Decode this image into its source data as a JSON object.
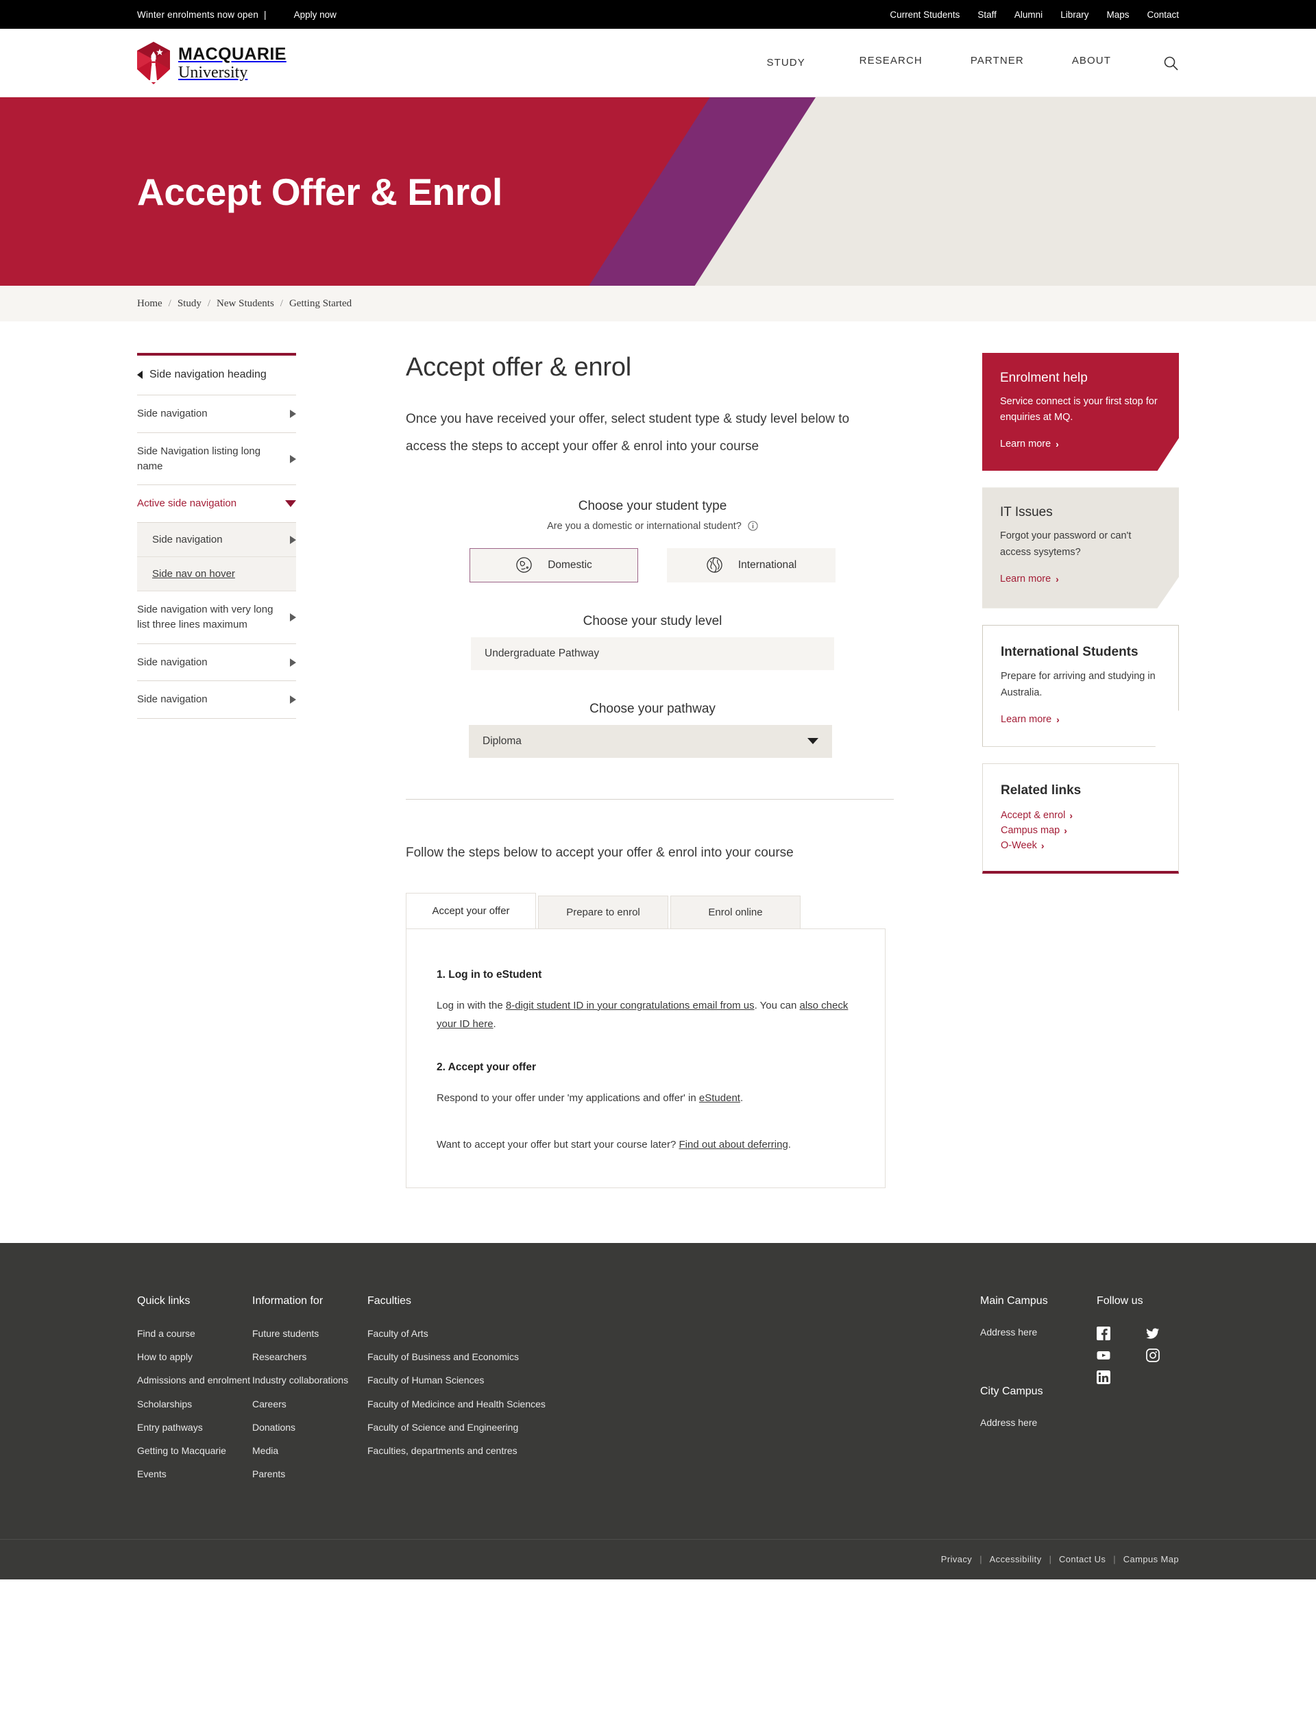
{
  "utility": {
    "promo": "Winter enrolments now open",
    "divider": "|",
    "apply": "Apply now",
    "links": [
      "Current Students",
      "Staff",
      "Alumni",
      "Library",
      "Maps",
      "Contact"
    ]
  },
  "header": {
    "logo_line1": "MACQUARIE",
    "logo_line2": "University",
    "nav": [
      "STUDY",
      "RESEARCH",
      "PARTNER",
      "ABOUT"
    ],
    "search_icon": "search-icon"
  },
  "hero": {
    "title": "Accept Offer & Enrol",
    "red": "#b01b36",
    "purple": "#7d2b72",
    "beige": "#ebe8e2"
  },
  "breadcrumb": {
    "items": [
      "Home",
      "Study",
      "New Students",
      "Getting Started"
    ],
    "separator": "/"
  },
  "sidenav": {
    "heading": "Side navigation heading",
    "items": [
      {
        "label": "Side navigation",
        "type": "item"
      },
      {
        "label": "Side Navigation listing long name",
        "type": "item"
      },
      {
        "label": "Active side navigation",
        "type": "active"
      },
      {
        "label": "Side navigation",
        "type": "sub"
      },
      {
        "label": "Side nav on hover",
        "type": "sub-hover"
      },
      {
        "label": "Side navigation with very long list three lines maximum",
        "type": "item"
      },
      {
        "label": "Side navigation",
        "type": "item"
      },
      {
        "label": "Side navigation",
        "type": "item"
      }
    ]
  },
  "main": {
    "title": "Accept offer & enrol",
    "intro": "Once you have received your offer, select student type & study level below to access the steps to accept your offer & enrol into your course",
    "student_type": {
      "label": "Choose your student type",
      "sublabel": "Are you a domestic or international student?",
      "info_icon": "info-icon",
      "options": [
        {
          "label": "Domestic",
          "icon": "globe-australia-icon",
          "selected": true
        },
        {
          "label": "International",
          "icon": "globe-world-icon",
          "selected": false
        }
      ]
    },
    "study_level": {
      "label": "Choose your study level",
      "value": "Undergraduate Pathway"
    },
    "pathway": {
      "label": "Choose your pathway",
      "value": "Diploma",
      "caret_icon": "chevron-down-icon"
    },
    "steps_heading": "Follow the steps below to accept your offer & enrol into your course",
    "tabs": [
      {
        "label": "Accept your offer",
        "active": true
      },
      {
        "label": "Prepare to enrol",
        "active": false
      },
      {
        "label": "Enrol online",
        "active": false
      }
    ],
    "panel": {
      "step1_title": "1. Log in to eStudent",
      "step1_body_a": "Log in with the ",
      "step1_link_a": "8-digit student ID in your congratulations email from us",
      "step1_body_b": ". You can ",
      "step1_link_b": "also check your ID here",
      "step1_body_c": ".",
      "step2_title": "2. Accept your offer",
      "step2_body_a": "Respond to your offer under 'my applications and offer' in ",
      "step2_link_a": "eStudent",
      "step2_body_b": ".",
      "step2_body_c": "Want to accept your offer but start your course later? ",
      "step2_link_b": "Find out about deferring",
      "step2_body_d": "."
    }
  },
  "right_cards": [
    {
      "id": "enrolment-help",
      "style": "red",
      "title": "Enrolment help",
      "body": "Service connect is your first stop for enquiries at MQ.",
      "link": "Learn more"
    },
    {
      "id": "it-issues",
      "style": "grey",
      "title": "IT Issues",
      "body": "Forgot your password or can't access sysytems?",
      "link": "Learn more"
    },
    {
      "id": "international-students",
      "style": "outline",
      "title": "International Students",
      "body": "Prepare for arriving and studying in Australia.",
      "link": "Learn more"
    }
  ],
  "related_links": {
    "title": "Related links",
    "items": [
      "Accept & enrol",
      "Campus map",
      "O-Week"
    ]
  },
  "footer": {
    "col1": {
      "title": "Quick links",
      "links": [
        "Find a course",
        "How to apply",
        "Admissions and enrolment",
        "Scholarships",
        "Entry pathways",
        "Getting to Macquarie",
        "Events"
      ]
    },
    "col2": {
      "title": "Information for",
      "links": [
        "Future students",
        "Researchers",
        "Industry collaborations",
        "Careers",
        "Donations",
        "Media",
        "Parents"
      ]
    },
    "col3": {
      "title": "Faculties",
      "links": [
        "Faculty of Arts",
        "Faculty of Business and Economics",
        "Faculty of Human Sciences",
        "Faculty of Medicince and Health Sciences",
        "Faculty of Science and Engineering",
        "Faculties, departments and centres"
      ]
    },
    "col4": {
      "campus1_title": "Main Campus",
      "campus1_address": "Address here",
      "campus2_title": "City Campus",
      "campus2_address": "Address here"
    },
    "col5": {
      "title": "Follow us",
      "socials": [
        "facebook-icon",
        "twitter-icon",
        "youtube-icon",
        "instagram-icon",
        "linkedin-icon"
      ]
    },
    "bottom_links": [
      "Privacy",
      "Accessibility",
      "Contact Us",
      "Campus Map"
    ],
    "bottom_sep": "|"
  }
}
